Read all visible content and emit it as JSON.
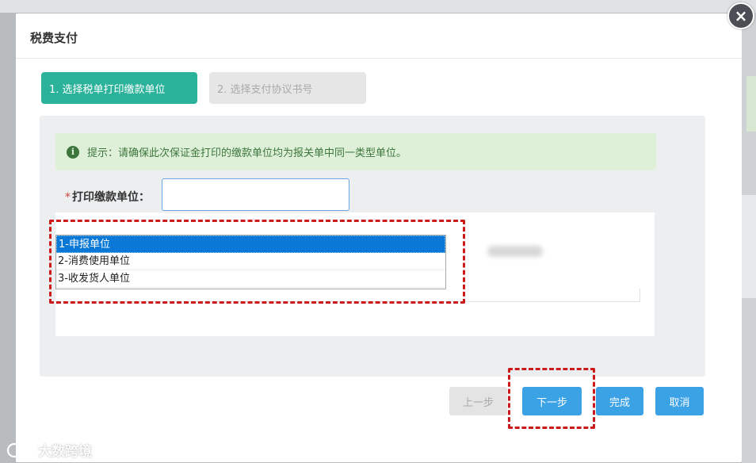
{
  "modal": {
    "title": "税费支付",
    "close_glyph": "×"
  },
  "steps": [
    {
      "label": "1. 选择税单打印缴款单位",
      "active": true
    },
    {
      "label": "2. 选择支付协议书号",
      "active": false
    }
  ],
  "tip": {
    "icon": "info-circle-icon",
    "glyph": "i",
    "text": "提示：请确保此次保证金打印的缴款单位均为报关单中同一类型单位。"
  },
  "form": {
    "required_mark": "*",
    "unit_label": "打印缴款单位：",
    "unit_value": ""
  },
  "dropdown": {
    "options": [
      "1-申报单位",
      "2-消费使用单位",
      "3-收发货人单位"
    ],
    "selected_index": 0
  },
  "buttons": {
    "prev": "上一步",
    "next": "下一步",
    "finish": "完成",
    "cancel": "取消"
  },
  "watermark": {
    "text": "大数跨境"
  },
  "colors": {
    "step_active": "#2bb29a",
    "primary_button": "#3ba2e6",
    "tip_background": "#dff0d8",
    "tip_text": "#3c763d",
    "dropdown_selected": "#0a78d7",
    "highlight_box": "#cc1a1a"
  }
}
